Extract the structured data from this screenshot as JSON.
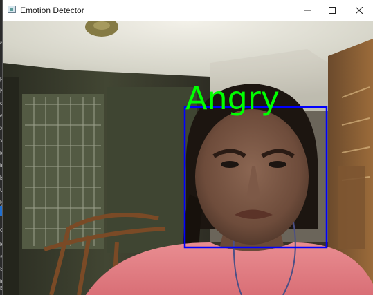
{
  "window": {
    "title": "Emotion Detector",
    "buttons": [
      "minimize",
      "maximize",
      "close"
    ]
  },
  "background_window": {
    "visible_chars": [
      "al",
      "p",
      "N",
      "c",
      "e",
      "x",
      "x",
      "le",
      "ir",
      "ls",
      "Ul",
      "ly",
      "C",
      "le",
      "s",
      "S",
      "ir",
      "E"
    ]
  },
  "detection": {
    "label": "Angry",
    "label_color": "#00ff00",
    "box_color": "#0000ff"
  },
  "icons": {
    "app": "app-window-icon",
    "minimize": "minimize-icon",
    "maximize": "maximize-icon",
    "close": "close-icon"
  }
}
